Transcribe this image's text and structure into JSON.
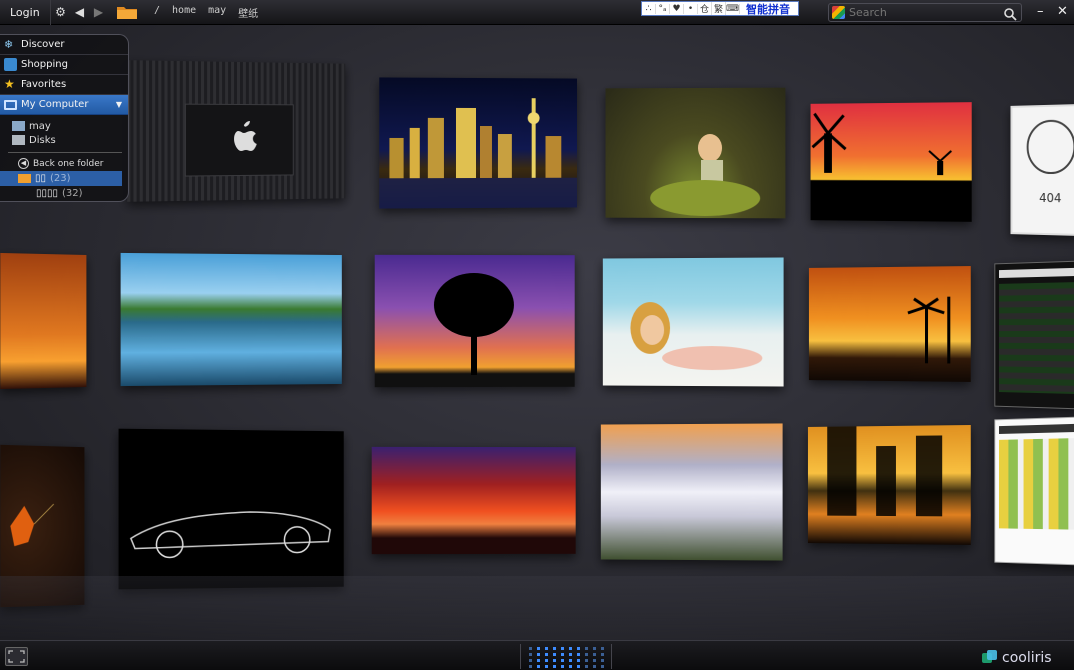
{
  "topbar": {
    "login": "Login",
    "breadcrumb": [
      "/",
      "home",
      "may",
      "壁纸"
    ],
    "ime": {
      "cells": [
        "∴",
        "°ₐ",
        "♥",
        "•",
        "仓",
        "繁",
        "⌨"
      ],
      "label": "智能拼音"
    },
    "search_placeholder": "Search"
  },
  "sidebar": {
    "items": [
      {
        "label": "Discover",
        "icon": "snowflake-icon"
      },
      {
        "label": "Shopping",
        "icon": "shopping-bag-icon"
      },
      {
        "label": "Favorites",
        "icon": "star-icon"
      },
      {
        "label": "My Computer",
        "icon": "monitor-icon"
      }
    ],
    "sub_items": [
      {
        "label": "may",
        "icon": "home-folder-icon"
      },
      {
        "label": "Disks",
        "icon": "disk-icon"
      }
    ],
    "back_label": "Back one folder",
    "folders": [
      {
        "name": "▯▯",
        "count": "(23)",
        "selected": true
      },
      {
        "name": "▯▯▯▯",
        "count": "(32)",
        "selected": false
      }
    ]
  },
  "bottombar": {
    "brand": "cooliris"
  },
  "colors": {
    "accent": "#2c5fa6",
    "background": "#2a2a30"
  }
}
